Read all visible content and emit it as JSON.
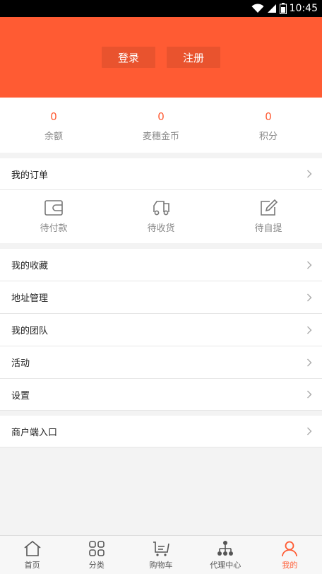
{
  "status_bar": {
    "time": "10:45"
  },
  "auth": {
    "login_label": "登录",
    "register_label": "注册"
  },
  "stats": [
    {
      "value": "0",
      "label": "余额"
    },
    {
      "value": "0",
      "label": "麦穗金币"
    },
    {
      "value": "0",
      "label": "积分"
    }
  ],
  "orders": {
    "title": "我的订单",
    "items": [
      {
        "label": "待付款",
        "icon": "wallet-icon"
      },
      {
        "label": "待收货",
        "icon": "truck-icon"
      },
      {
        "label": "待自提",
        "icon": "edit-icon"
      }
    ]
  },
  "menu": [
    {
      "label": "我的收藏"
    },
    {
      "label": "地址管理"
    },
    {
      "label": "我的团队"
    },
    {
      "label": "活动"
    },
    {
      "label": "设置"
    }
  ],
  "merchant": {
    "label": "商户端入口"
  },
  "tabbar": [
    {
      "label": "首页",
      "icon": "home-icon"
    },
    {
      "label": "分类",
      "icon": "grid-icon"
    },
    {
      "label": "购物车",
      "icon": "cart-icon"
    },
    {
      "label": "代理中心",
      "icon": "network-icon"
    },
    {
      "label": "我的",
      "icon": "user-icon",
      "active": true
    }
  ],
  "colors": {
    "accent": "#ff5b33",
    "header_button": "#e9532e"
  }
}
